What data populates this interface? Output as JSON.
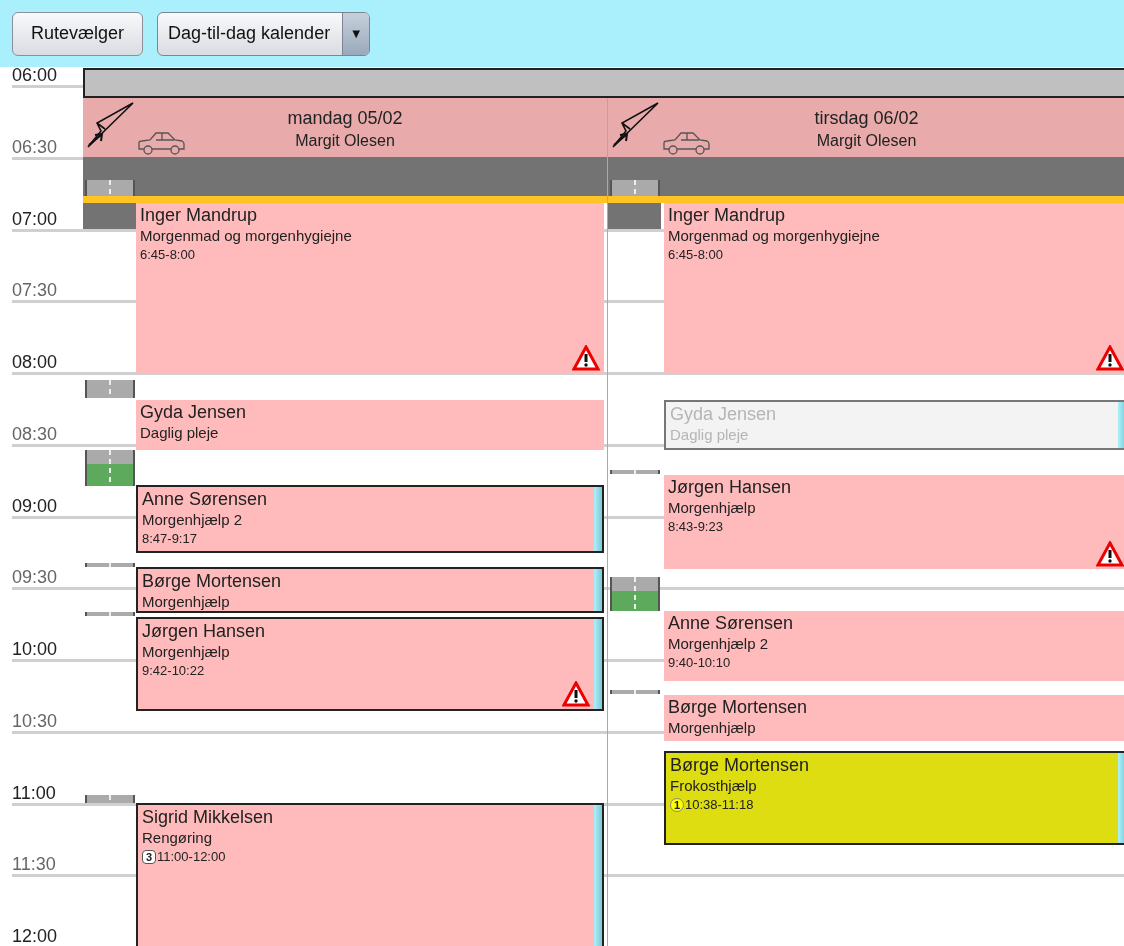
{
  "toolbar": {
    "route_button": "Rutevælger",
    "view_dropdown": {
      "value": "Dag-til-dag kalender",
      "arrow": "▼"
    }
  },
  "times": [
    "06:00",
    "06:30",
    "07:00",
    "07:30",
    "08:00",
    "08:30",
    "09:00",
    "09:30",
    "10:00",
    "10:30",
    "11:00",
    "11:30",
    "12:00"
  ],
  "days": [
    {
      "date": "mandag 05/02",
      "person": "Margit Olesen",
      "events": [
        {
          "name": "Inger Mandrup",
          "task": "Morgenmad og morgenhygiejne",
          "time": "6:45-8:00",
          "color": "#ffbbbb",
          "outlined": false,
          "disabled": false,
          "warning": true
        },
        {
          "name": "Gyda Jensen",
          "task": "Daglig pleje",
          "color": "#ffbbbb",
          "outlined": false,
          "disabled": false,
          "warning": false
        },
        {
          "name": "Anne Sørensen",
          "task": "Morgenhjælp 2",
          "time": "8:47-9:17",
          "color": "#ffbbbb",
          "outlined": true,
          "disabled": false,
          "warning": false
        },
        {
          "name": "Børge Mortensen",
          "task": "Morgenhjælp",
          "color": "#ffbbbb",
          "outlined": true,
          "disabled": false,
          "warning": false
        },
        {
          "name": "Jørgen Hansen",
          "task": "Morgenhjælp",
          "time": "9:42-10:22",
          "color": "#ffbbbb",
          "outlined": true,
          "disabled": false,
          "warning": true
        },
        {
          "name": "Sigrid Mikkelsen",
          "task": "Rengøring",
          "time": "11:00-12:00",
          "badge": {
            "text": "3",
            "kind": "square"
          },
          "color": "#ffbbbb",
          "outlined": true,
          "disabled": false,
          "warning": false
        }
      ]
    },
    {
      "date": "tirsdag 06/02",
      "person": "Margit Olesen",
      "events": [
        {
          "name": "Inger Mandrup",
          "task": "Morgenmad og morgenhygiejne",
          "time": "6:45-8:00",
          "color": "#ffbbbb",
          "outlined": false,
          "disabled": false,
          "warning": true
        },
        {
          "name": "Gyda Jensen",
          "task": "Daglig pleje",
          "color": "#f3f3f3",
          "outlined": true,
          "disabled": true,
          "warning": false
        },
        {
          "name": "Jørgen Hansen",
          "task": "Morgenhjælp",
          "time": "8:43-9:23",
          "color": "#ffbbbb",
          "outlined": false,
          "disabled": false,
          "warning": true
        },
        {
          "name": "Anne Sørensen",
          "task": "Morgenhjælp 2",
          "time": "9:40-10:10",
          "color": "#ffbbbb",
          "outlined": false,
          "disabled": false,
          "warning": false
        },
        {
          "name": "Børge Mortensen",
          "task": "Morgenhjælp",
          "color": "#ffbbbb",
          "outlined": false,
          "disabled": false,
          "warning": false
        },
        {
          "name": "Børge Mortensen",
          "task": "Frokosthjælp",
          "time": "10:38-11:18",
          "badge": {
            "text": "1",
            "kind": "circle"
          },
          "color": "#dddd11",
          "outlined": true,
          "disabled": false,
          "warning": false
        }
      ]
    }
  ]
}
